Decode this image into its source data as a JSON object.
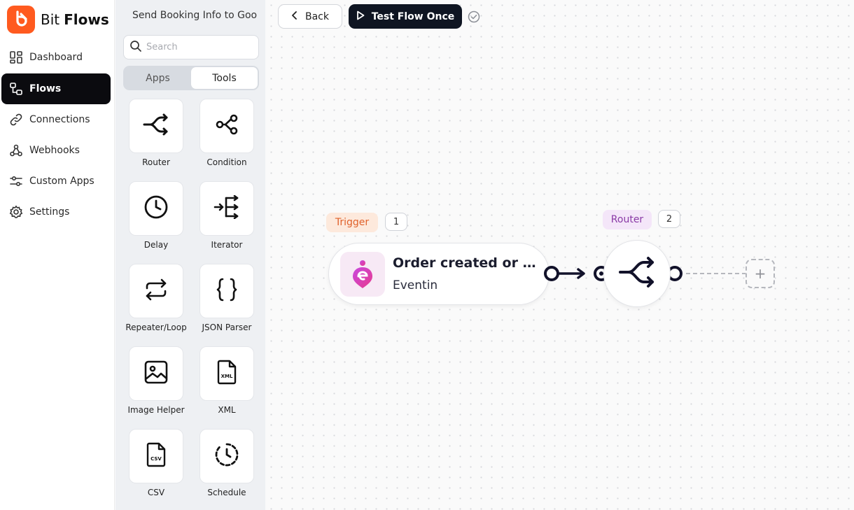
{
  "brand": {
    "name_light": "Bit",
    "name_bold": "Flows",
    "color": "#ff5a1f"
  },
  "nav": {
    "items": [
      {
        "label": "Dashboard",
        "icon": "dashboard-icon"
      },
      {
        "label": "Flows",
        "icon": "flows-icon",
        "active": true
      },
      {
        "label": "Connections",
        "icon": "link-icon"
      },
      {
        "label": "Webhooks",
        "icon": "webhook-icon"
      },
      {
        "label": "Custom Apps",
        "icon": "sliders-icon"
      },
      {
        "label": "Settings",
        "icon": "gear-icon"
      }
    ]
  },
  "panel": {
    "title": "Send Booking Info to Goo",
    "search_placeholder": "Search",
    "tabs": [
      "Apps",
      "Tools"
    ],
    "active_tab": "Tools",
    "tools": [
      {
        "label": "Router",
        "icon": "router-icon"
      },
      {
        "label": "Condition",
        "icon": "condition-icon"
      },
      {
        "label": "Delay",
        "icon": "clock-icon"
      },
      {
        "label": "Iterator",
        "icon": "iterator-icon"
      },
      {
        "label": "Repeater/Loop",
        "icon": "repeat-icon"
      },
      {
        "label": "JSON Parser",
        "icon": "braces-icon"
      },
      {
        "label": "Image Helper",
        "icon": "image-icon"
      },
      {
        "label": "XML",
        "icon": "xml-file-icon"
      },
      {
        "label": "CSV",
        "icon": "csv-file-icon"
      },
      {
        "label": "Schedule",
        "icon": "schedule-icon"
      }
    ]
  },
  "toolbar": {
    "back_label": "Back",
    "test_label": "Test Flow Once"
  },
  "flow": {
    "trigger": {
      "badge": "Trigger",
      "step": "1",
      "title": "Order created or Ti...",
      "app": "Eventin"
    },
    "router": {
      "badge": "Router",
      "step": "2"
    },
    "add_label": "+"
  }
}
